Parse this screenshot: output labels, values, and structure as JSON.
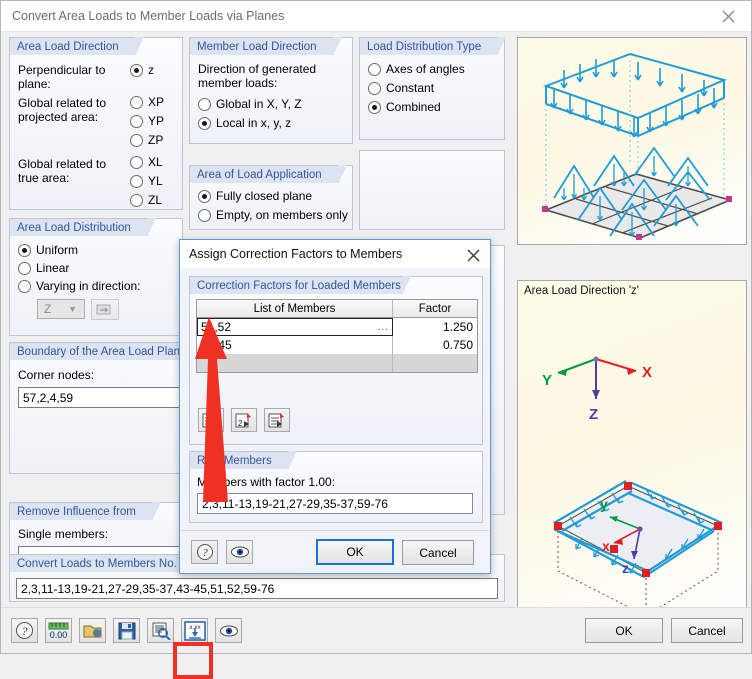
{
  "window": {
    "title": "Convert Area Loads to Member Loads via Planes",
    "close_icon": "close-icon"
  },
  "area_load_direction": {
    "header": "Area Load Direction",
    "label_perpendicular": "Perpendicular to plane:",
    "label_projected": "Global related to projected area:",
    "label_true": "Global related to true area:",
    "options": [
      {
        "label": "z",
        "selected": true
      },
      {
        "label": "XP",
        "selected": false
      },
      {
        "label": "YP",
        "selected": false
      },
      {
        "label": "ZP",
        "selected": false
      },
      {
        "label": "XL",
        "selected": false
      },
      {
        "label": "YL",
        "selected": false
      },
      {
        "label": "ZL",
        "selected": false
      }
    ]
  },
  "area_load_distribution": {
    "header": "Area Load Distribution",
    "options": [
      {
        "label": "Uniform",
        "selected": true
      },
      {
        "label": "Linear",
        "selected": false
      },
      {
        "label": "Varying in direction:",
        "selected": false
      }
    ],
    "direction_value": "Z",
    "picker_icon": "select-direction-icon"
  },
  "boundary": {
    "header": "Boundary of the Area Load Plane",
    "label": "Corner nodes:",
    "value": "57,2,4,59"
  },
  "remove_influence": {
    "header": "Remove Influence from",
    "label": "Single members:",
    "value": ""
  },
  "convert_loads": {
    "header": "Convert Loads to Members No.",
    "value": "2,3,11-13,19-21,27-29,35-37,43-45,51,52,59-76"
  },
  "member_load_direction": {
    "header": "Member Load Direction",
    "label": "Direction of generated member loads:",
    "options": [
      {
        "label": "Global in X, Y, Z",
        "selected": false
      },
      {
        "label": "Local in x, y, z",
        "selected": true
      }
    ]
  },
  "area_of_load_application": {
    "header": "Area of Load Application",
    "options": [
      {
        "label": "Fully closed plane",
        "selected": true
      },
      {
        "label": "Empty, on members only",
        "selected": false
      }
    ]
  },
  "load_distribution_type": {
    "header": "Load Distribution Type",
    "options": [
      {
        "label": "Axes of angles",
        "selected": false
      },
      {
        "label": "Constant",
        "selected": false
      },
      {
        "label": "Combined",
        "selected": true
      }
    ]
  },
  "previews": {
    "top": {
      "name": "load-conversion-diagram"
    },
    "bottom_label": "Area Load Direction 'z'",
    "axes": {
      "x": "X",
      "y": "Y",
      "z": "Z"
    },
    "axes_local": {
      "x": "x",
      "y": "y",
      "z": "z"
    }
  },
  "toolbar": {
    "buttons": [
      {
        "icon": "help-icon",
        "label": "?"
      },
      {
        "icon": "units-icon",
        "label": "0.00"
      },
      {
        "icon": "open-folder-icon",
        "label": ""
      },
      {
        "icon": "save-icon",
        "label": ""
      },
      {
        "icon": "report-preview-icon",
        "label": ""
      },
      {
        "icon": "convert-loads-icon",
        "label": "x.xx",
        "highlighted": true
      },
      {
        "icon": "eye-visibility-icon",
        "label": ""
      }
    ],
    "ok_label": "OK",
    "cancel_label": "Cancel"
  },
  "modal": {
    "title": "Assign Correction Factors to Members",
    "close_icon": "close-icon",
    "group_header": "Correction Factors for Loaded Members",
    "table": {
      "columns": [
        "List of Members",
        "Factor"
      ],
      "rows": [
        {
          "members": "51,52",
          "factor": "1.250",
          "selected": true
        },
        {
          "members": "43-45",
          "factor": "0.750",
          "selected": false
        }
      ]
    },
    "row_buttons": [
      {
        "icon": "insert-row-icon",
        "label": "1"
      },
      {
        "icon": "duplicate-row-icon",
        "label": "2"
      },
      {
        "icon": "delete-row-icon",
        "label": ""
      }
    ],
    "rest_members": {
      "header": "Rest Members",
      "label": "Members with factor 1.00:",
      "value": "2,3,11-13,19-21,27-29,35-37,59-76"
    },
    "footer_icons": [
      {
        "icon": "help-circle-icon"
      },
      {
        "icon": "eye-visibility-icon"
      }
    ],
    "ok_label": "OK",
    "cancel_label": "Cancel"
  },
  "colors": {
    "accent": "#1e6fd9",
    "group_header_text": "#33559b",
    "highlight": "#ef3124",
    "diagram_blue": "#1f9cd8",
    "axis_x": "#e02020",
    "axis_y": "#009b3a",
    "axis_z": "#4b3fa0"
  }
}
